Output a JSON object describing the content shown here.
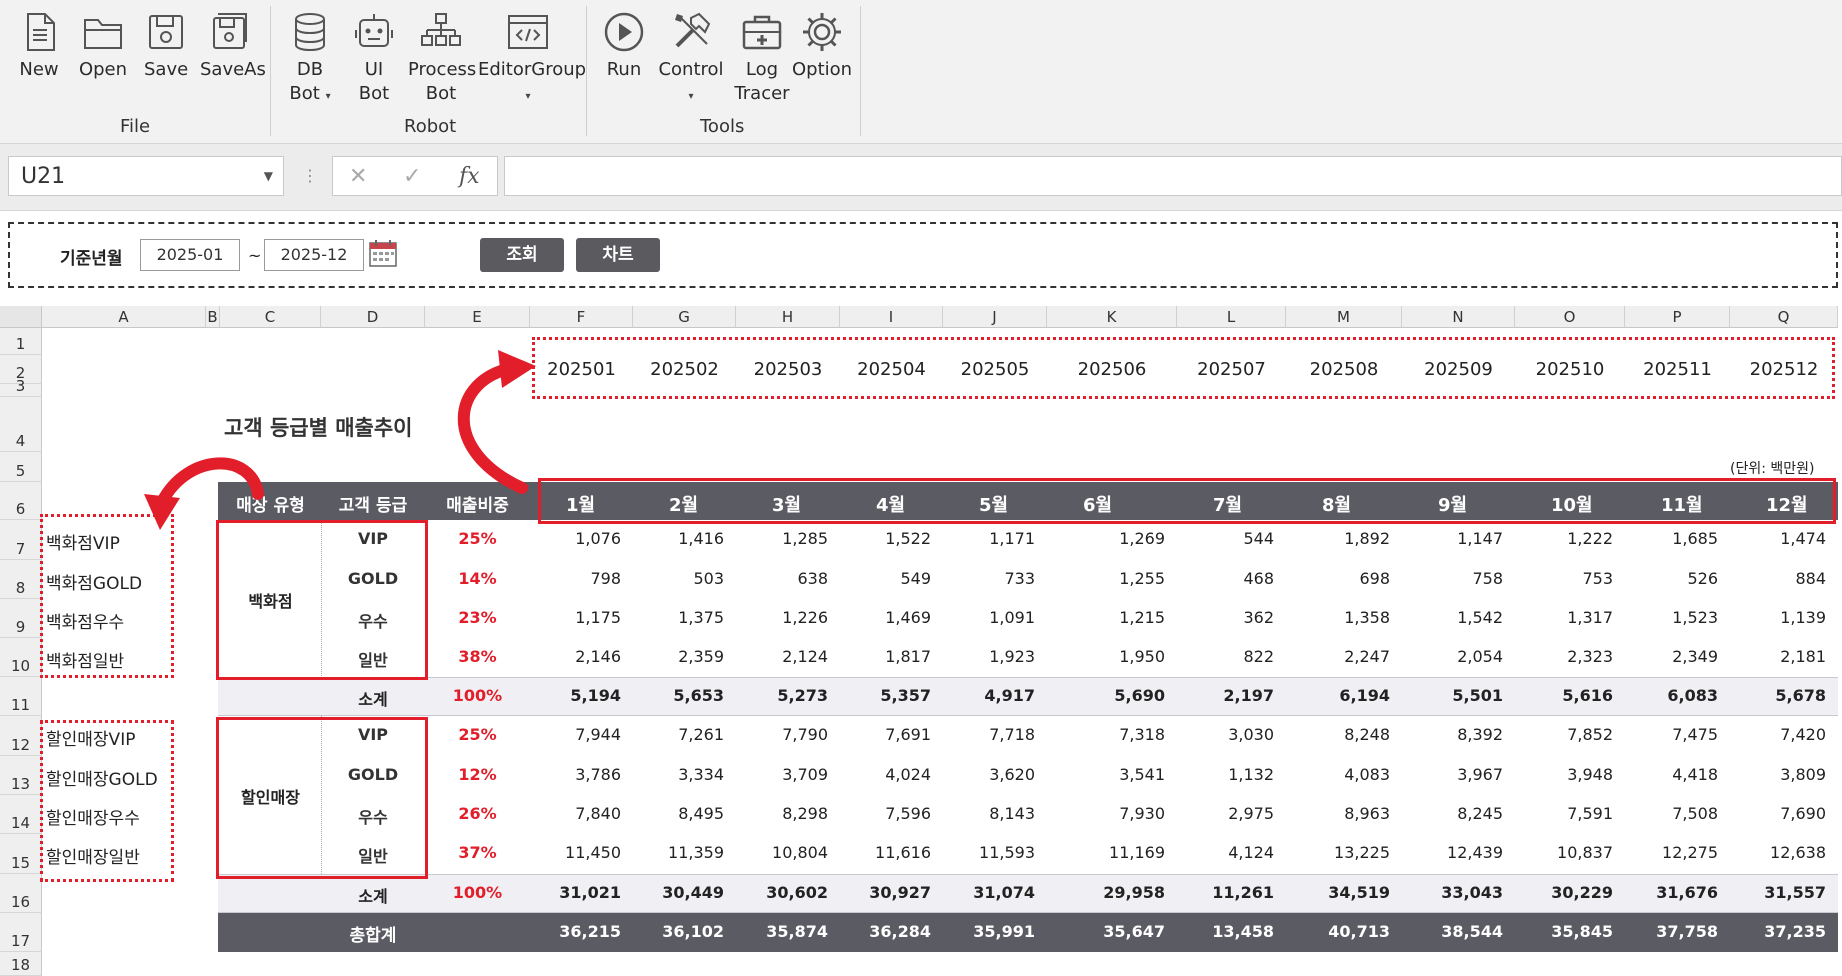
{
  "ribbon": {
    "groups": [
      {
        "label": "File",
        "buttons": [
          {
            "label": "New",
            "icon": "new-file-icon"
          },
          {
            "label": "Open",
            "icon": "folder-icon"
          },
          {
            "label": "Save",
            "icon": "save-icon"
          },
          {
            "label": "SaveAs",
            "icon": "save-as-icon"
          }
        ]
      },
      {
        "label": "Robot",
        "buttons": [
          {
            "label": "DB",
            "label2": "Bot",
            "icon": "database-icon"
          },
          {
            "label": "UI",
            "label2": "Bot",
            "icon": "robot-icon"
          },
          {
            "label": "Process",
            "label2": "Bot",
            "icon": "process-tree-icon"
          },
          {
            "label": "EditorGroup",
            "icon": "code-window-icon"
          }
        ]
      },
      {
        "label": "Tools",
        "buttons": [
          {
            "label": "Run",
            "icon": "play-icon"
          },
          {
            "label": "Control",
            "icon": "tools-icon"
          },
          {
            "label": "Log",
            "label2": "Tracer",
            "icon": "log-tracer-icon"
          },
          {
            "label": "Option",
            "icon": "gear-icon"
          }
        ]
      }
    ]
  },
  "formula_bar": {
    "name_box": "U21",
    "separator": "⋮",
    "cancel": "✕",
    "confirm": "✓",
    "fx": "fx",
    "formula": ""
  },
  "filter": {
    "label": "기준년월",
    "from": "2025-01",
    "tilde": "~",
    "to": "2025-12",
    "query_button": "조회",
    "chart_button": "차트"
  },
  "sheet": {
    "columns": [
      "A",
      "B",
      "C",
      "D",
      "E",
      "F",
      "G",
      "H",
      "I",
      "J",
      "K",
      "L",
      "M",
      "N",
      "O",
      "P",
      "Q"
    ],
    "rows": [
      "1",
      "2",
      "3",
      "4",
      "5",
      "6",
      "7",
      "8",
      "9",
      "10",
      "11",
      "12",
      "13",
      "14",
      "15",
      "16",
      "17",
      "18"
    ],
    "title": "고객 등급별 매출추이",
    "unit": "(단위: 백만원)",
    "yyyymm": [
      "202501",
      "202502",
      "202503",
      "202504",
      "202505",
      "202506",
      "202507",
      "202508",
      "202509",
      "202510",
      "202511",
      "202512"
    ],
    "header": {
      "store_type": "매장 유형",
      "grade": "고객 등급",
      "share": "매출비중",
      "months": [
        "1월",
        "2월",
        "3월",
        "4월",
        "5월",
        "6월",
        "7월",
        "8월",
        "9월",
        "10월",
        "11월",
        "12월"
      ]
    },
    "keys_dept": [
      "백화점VIP",
      "백화점GOLD",
      "백화점우수",
      "백화점일반"
    ],
    "keys_disc": [
      "할인매장VIP",
      "할인매장GOLD",
      "할인매장우수",
      "할인매장일반"
    ],
    "dept": {
      "name": "백화점",
      "rows": [
        {
          "grade": "VIP",
          "share": "25%",
          "values": [
            "1,076",
            "1,416",
            "1,285",
            "1,522",
            "1,171",
            "1,269",
            "544",
            "1,892",
            "1,147",
            "1,222",
            "1,685",
            "1,474"
          ]
        },
        {
          "grade": "GOLD",
          "share": "14%",
          "values": [
            "798",
            "503",
            "638",
            "549",
            "733",
            "1,255",
            "468",
            "698",
            "758",
            "753",
            "526",
            "884"
          ]
        },
        {
          "grade": "우수",
          "share": "23%",
          "values": [
            "1,175",
            "1,375",
            "1,226",
            "1,469",
            "1,091",
            "1,215",
            "362",
            "1,358",
            "1,542",
            "1,317",
            "1,523",
            "1,139"
          ]
        },
        {
          "grade": "일반",
          "share": "38%",
          "values": [
            "2,146",
            "2,359",
            "2,124",
            "1,817",
            "1,923",
            "1,950",
            "822",
            "2,247",
            "2,054",
            "2,323",
            "2,349",
            "2,181"
          ]
        }
      ],
      "subtotal": {
        "label": "소계",
        "share": "100%",
        "values": [
          "5,194",
          "5,653",
          "5,273",
          "5,357",
          "4,917",
          "5,690",
          "2,197",
          "6,194",
          "5,501",
          "5,616",
          "6,083",
          "5,678"
        ]
      }
    },
    "disc": {
      "name": "할인매장",
      "rows": [
        {
          "grade": "VIP",
          "share": "25%",
          "values": [
            "7,944",
            "7,261",
            "7,790",
            "7,691",
            "7,718",
            "7,318",
            "3,030",
            "8,248",
            "8,392",
            "7,852",
            "7,475",
            "7,420"
          ]
        },
        {
          "grade": "GOLD",
          "share": "12%",
          "values": [
            "3,786",
            "3,334",
            "3,709",
            "4,024",
            "3,620",
            "3,541",
            "1,132",
            "4,083",
            "3,967",
            "3,948",
            "4,418",
            "3,809"
          ]
        },
        {
          "grade": "우수",
          "share": "26%",
          "values": [
            "7,840",
            "8,495",
            "8,298",
            "7,596",
            "8,143",
            "7,930",
            "2,975",
            "8,963",
            "8,245",
            "7,591",
            "7,508",
            "7,690"
          ]
        },
        {
          "grade": "일반",
          "share": "37%",
          "values": [
            "11,450",
            "11,359",
            "10,804",
            "11,616",
            "11,593",
            "11,169",
            "4,124",
            "13,225",
            "12,439",
            "10,837",
            "12,275",
            "12,638"
          ]
        }
      ],
      "subtotal": {
        "label": "소계",
        "share": "100%",
        "values": [
          "31,021",
          "30,449",
          "30,602",
          "30,927",
          "31,074",
          "29,958",
          "11,261",
          "34,519",
          "33,043",
          "30,229",
          "31,676",
          "31,557"
        ]
      }
    },
    "grand_total": {
      "label": "총합계",
      "values": [
        "36,215",
        "36,102",
        "35,874",
        "36,284",
        "35,991",
        "35,647",
        "13,458",
        "40,713",
        "38,544",
        "35,845",
        "37,758",
        "37,235"
      ]
    }
  },
  "colors": {
    "header_band": "#5b5b63",
    "accent_red": "#e21e2b",
    "subtotal_band": "#f0f0f4"
  }
}
